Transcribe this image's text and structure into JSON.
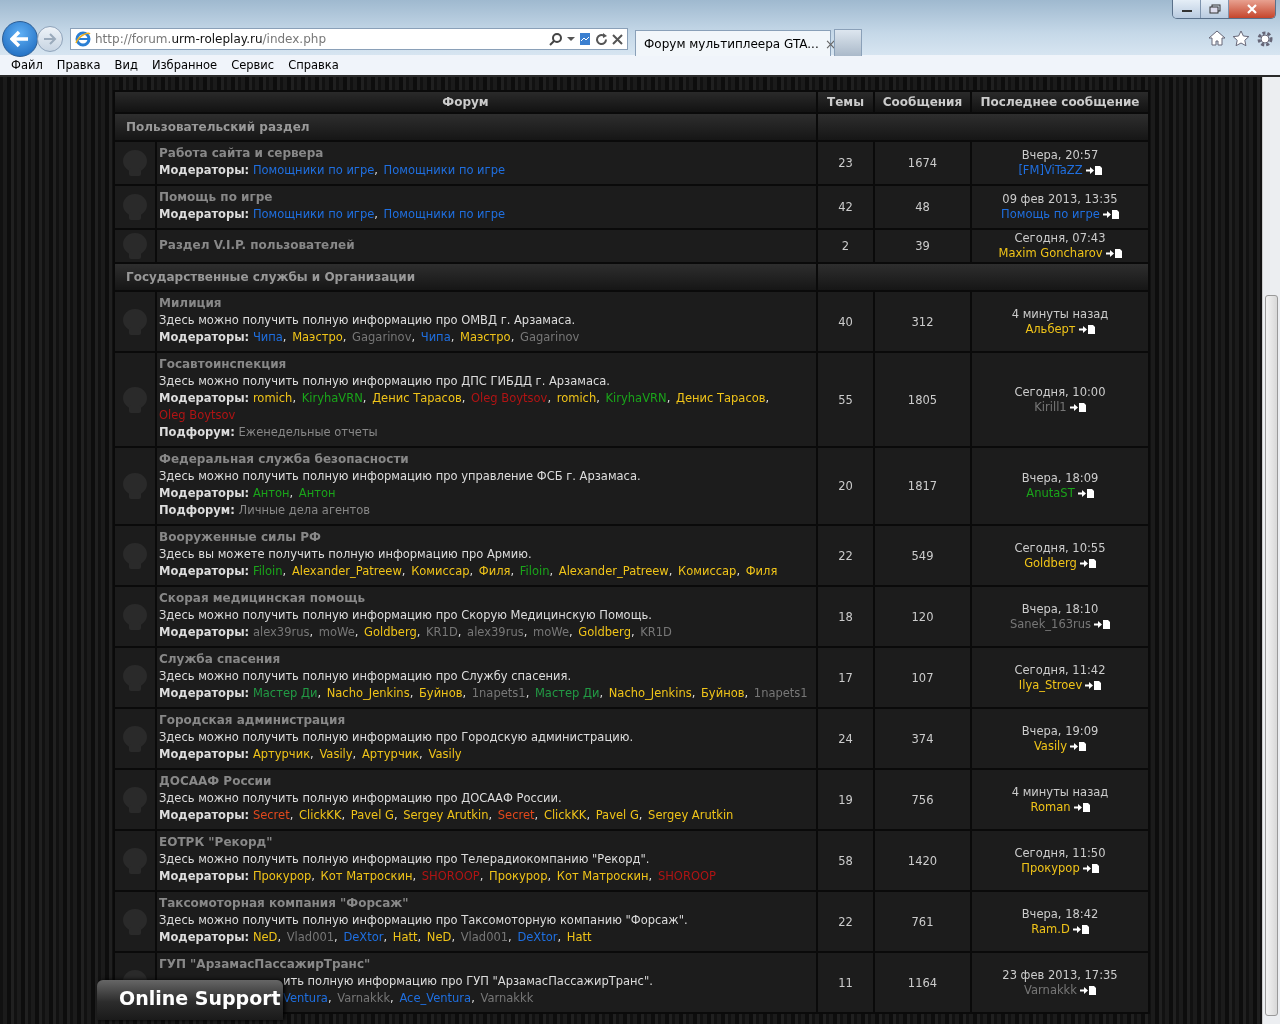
{
  "browser": {
    "address": {
      "prefix": "http://forum.",
      "domain": "urm-roleplay.ru",
      "path": "/index.php"
    },
    "tab_title": "Форум мультиплеера GTA...",
    "tab_close": "×"
  },
  "menu": [
    "Файл",
    "Правка",
    "Вид",
    "Избранное",
    "Сервис",
    "Справка"
  ],
  "table": {
    "columns": [
      "Форум",
      "Темы",
      "Сообщения",
      "Последнее сообщение"
    ],
    "separator": ",",
    "sections": [
      {
        "title": "Пользовательский раздел",
        "forums": [
          {
            "title": "Работа сайта и сервера",
            "moderators_label": "Модераторы:",
            "moderators": [
              {
                "name": "Помощники по игре",
                "color": "#1f6fe0"
              },
              {
                "name": "Помощники по игре",
                "color": "#1f6fe0"
              }
            ],
            "topics": "23",
            "posts": "1674",
            "last_time": "Вчера, 20:57",
            "last_author": {
              "name": "[FM]ViTaZZ",
              "color": "#1f6fe0"
            }
          },
          {
            "title": "Помощь по игре",
            "moderators_label": "Модераторы:",
            "moderators": [
              {
                "name": "Помощники по игре",
                "color": "#1f6fe0"
              },
              {
                "name": "Помощники по игре",
                "color": "#1f6fe0"
              }
            ],
            "topics": "42",
            "posts": "48",
            "last_time": "09 фев 2013, 13:35",
            "last_author": {
              "name": "Помощь по игре",
              "color": "#1f6fe0"
            }
          },
          {
            "title": "Раздел V.I.P. пользователей",
            "topics": "2",
            "posts": "39",
            "last_time": "Сегодня, 07:43",
            "last_author": {
              "name": "Maxim Goncharov",
              "color": "#f0c419"
            }
          }
        ]
      },
      {
        "title": "Государственные службы и Организации",
        "forums": [
          {
            "title": "Милиция",
            "description": "Здесь можно получить полную информацию про ОМВД г. Арзамаса.",
            "moderators_label": "Модераторы:",
            "moderators": [
              {
                "name": "Чипа",
                "color": "#1f6fe0"
              },
              {
                "name": "Маэстро",
                "color": "#f0c419"
              },
              {
                "name": "Gagarinov",
                "color": "#777777"
              },
              {
                "name": "Чипа",
                "color": "#1f6fe0"
              },
              {
                "name": "Маэстро",
                "color": "#f0c419"
              },
              {
                "name": "Gagarinov",
                "color": "#777777"
              }
            ],
            "topics": "40",
            "posts": "312",
            "last_time": "4 минуты назад",
            "last_author": {
              "name": "Альберт",
              "color": "#f0c419"
            }
          },
          {
            "title": "Госавтоинспекция",
            "description": "Здесь можно получить полную информацию про ДПС ГИБДД г. Арзамаса.",
            "moderators_label": "Модераторы:",
            "moderators": [
              {
                "name": "romich",
                "color": "#f0c419"
              },
              {
                "name": "KiryhaVRN",
                "color": "#1aa51a"
              },
              {
                "name": "Денис Тарасов",
                "color": "#f0c419"
              },
              {
                "name": "Oleg Boytsov",
                "color": "#b01414"
              },
              {
                "name": "romich",
                "color": "#f0c419"
              },
              {
                "name": "KiryhaVRN",
                "color": "#1aa51a"
              },
              {
                "name": "Денис Тарасов",
                "color": "#f0c419"
              },
              {
                "name": "Oleg Boytsov",
                "color": "#b01414"
              }
            ],
            "subforum_label": "Подфорум:",
            "subforum": "Еженедельные отчеты",
            "topics": "55",
            "posts": "1805",
            "last_time": "Сегодня, 10:00",
            "last_author": {
              "name": "Kirill1",
              "color": "#777777"
            }
          },
          {
            "title": "Федеральная служба безопасности",
            "description": "Здесь можно получить полную информацию про управление ФСБ г. Арзамаса.",
            "moderators_label": "Модераторы:",
            "moderators": [
              {
                "name": "Антон",
                "color": "#1aa51a"
              },
              {
                "name": "Антон",
                "color": "#1aa51a"
              }
            ],
            "subforum_label": "Подфорум:",
            "subforum": "Личные дела агентов",
            "topics": "20",
            "posts": "1817",
            "last_time": "Вчера, 18:09",
            "last_author": {
              "name": "AnutaST",
              "color": "#1aa51a"
            }
          },
          {
            "title": "Вооруженные силы РФ",
            "description": "Здесь вы можете получить полную информацию про Армию.",
            "moderators_label": "Модераторы:",
            "moderators": [
              {
                "name": "Filoin",
                "color": "#1aa51a"
              },
              {
                "name": "Alexander_Patreew",
                "color": "#f0c419"
              },
              {
                "name": "Комиссар",
                "color": "#f0c419"
              },
              {
                "name": "Филя",
                "color": "#f0c419"
              },
              {
                "name": "Filoin",
                "color": "#1aa51a"
              },
              {
                "name": "Alexander_Patreew",
                "color": "#f0c419"
              },
              {
                "name": "Комиссар",
                "color": "#f0c419"
              },
              {
                "name": "Филя",
                "color": "#f0c419"
              }
            ],
            "topics": "22",
            "posts": "549",
            "last_time": "Сегодня, 10:55",
            "last_author": {
              "name": "Goldberg",
              "color": "#f0c419"
            }
          },
          {
            "title": "Скорая медицинская помощь",
            "description": "Здесь можно получить полную информацию про Скорую Медицинскую Помощь.",
            "moderators_label": "Модераторы:",
            "moderators": [
              {
                "name": "alex39rus",
                "color": "#777777"
              },
              {
                "name": "moWe",
                "color": "#777777"
              },
              {
                "name": "Goldberg",
                "color": "#f0c419"
              },
              {
                "name": "KR1D",
                "color": "#777777"
              },
              {
                "name": "alex39rus",
                "color": "#777777"
              },
              {
                "name": "moWe",
                "color": "#777777"
              },
              {
                "name": "Goldberg",
                "color": "#f0c419"
              },
              {
                "name": "KR1D",
                "color": "#777777"
              }
            ],
            "topics": "18",
            "posts": "120",
            "last_time": "Вчера, 18:10",
            "last_author": {
              "name": "Sanek_163rus",
              "color": "#777777"
            }
          },
          {
            "title": "Служба спасения",
            "description": "Здесь можно получить полную информацию про Службу спасения.",
            "moderators_label": "Модераторы:",
            "moderators": [
              {
                "name": "Мастер Ди",
                "color": "#229944"
              },
              {
                "name": "Nacho_Jenkins",
                "color": "#f0c419"
              },
              {
                "name": "Буйнов",
                "color": "#f0c419"
              },
              {
                "name": "1napets1",
                "color": "#777777"
              },
              {
                "name": "Мастер Ди",
                "color": "#229944"
              },
              {
                "name": "Nacho_Jenkins",
                "color": "#f0c419"
              },
              {
                "name": "Буйнов",
                "color": "#f0c419"
              },
              {
                "name": "1napets1",
                "color": "#777777"
              }
            ],
            "topics": "17",
            "posts": "107",
            "last_time": "Сегодня, 11:42",
            "last_author": {
              "name": "Ilya_Stroev",
              "color": "#f0c419"
            }
          },
          {
            "title": "Городская администрация",
            "description": "Здесь можно получить полную информацию про Городскую администрацию.",
            "moderators_label": "Модераторы:",
            "moderators": [
              {
                "name": "Артурчик",
                "color": "#f0c419"
              },
              {
                "name": "Vasily",
                "color": "#f0c419"
              },
              {
                "name": "Артурчик",
                "color": "#f0c419"
              },
              {
                "name": "Vasily",
                "color": "#f0c419"
              }
            ],
            "topics": "24",
            "posts": "374",
            "last_time": "Вчера, 19:09",
            "last_author": {
              "name": "Vasily",
              "color": "#f0c419"
            }
          },
          {
            "title": "ДОСААФ России",
            "description": "Здесь можно получить полную информацию про ДОСААФ России.",
            "moderators_label": "Модераторы:",
            "moderators": [
              {
                "name": "Secret",
                "color": "#e2481c"
              },
              {
                "name": "ClickKK",
                "color": "#f0c419"
              },
              {
                "name": "Pavel G",
                "color": "#f0c419"
              },
              {
                "name": "Sergey Arutkin",
                "color": "#f0c419"
              },
              {
                "name": "Secret",
                "color": "#e2481c"
              },
              {
                "name": "ClickKK",
                "color": "#f0c419"
              },
              {
                "name": "Pavel G",
                "color": "#f0c419"
              },
              {
                "name": "Sergey Arutkin",
                "color": "#f0c419"
              }
            ],
            "topics": "19",
            "posts": "756",
            "last_time": "4 минуты назад",
            "last_author": {
              "name": "Roman",
              "color": "#f0c419"
            }
          },
          {
            "title": "ЕОТРК \"Рекорд\"",
            "description": "Здесь можно получить полную информацию про Телерадиокомпанию \"Рекорд\".",
            "moderators_label": "Модераторы:",
            "moderators": [
              {
                "name": "Прокурор",
                "color": "#f0c419"
              },
              {
                "name": "Кот Матроскин",
                "color": "#f0c419"
              },
              {
                "name": "SHOROOP",
                "color": "#b01414"
              },
              {
                "name": "Прокурор",
                "color": "#f0c419"
              },
              {
                "name": "Кот Матроскин",
                "color": "#f0c419"
              },
              {
                "name": "SHOROOP",
                "color": "#b01414"
              }
            ],
            "topics": "58",
            "posts": "1420",
            "last_time": "Сегодня, 11:50",
            "last_author": {
              "name": "Прокурор",
              "color": "#f0c419"
            }
          },
          {
            "title": "Таксомоторная компания \"Форсаж\"",
            "description": "Здесь можно получить полную информацию про Таксомоторную компанию \"Форсаж\".",
            "moderators_label": "Модераторы:",
            "moderators": [
              {
                "name": "NeD",
                "color": "#f0c419"
              },
              {
                "name": "Vlad001",
                "color": "#777777"
              },
              {
                "name": "DeXtor",
                "color": "#1f6fe0"
              },
              {
                "name": "Hatt",
                "color": "#f0c419"
              },
              {
                "name": "NeD",
                "color": "#f0c419"
              },
              {
                "name": "Vlad001",
                "color": "#777777"
              },
              {
                "name": "DeXtor",
                "color": "#1f6fe0"
              },
              {
                "name": "Hatt",
                "color": "#f0c419"
              }
            ],
            "topics": "22",
            "posts": "761",
            "last_time": "Вчера, 18:42",
            "last_author": {
              "name": "Ram.D",
              "color": "#f0c419"
            }
          },
          {
            "title": "ГУП \"АрзамасПассажирТранс\"",
            "covered": true,
            "description": "ить полную информацию про ГУП \"АрзамасПассажирТранс\".",
            "moderators": [
              {
                "name": "Ventura",
                "color": "#1f6fe0"
              },
              {
                "name": "Varnakkk",
                "color": "#777777"
              },
              {
                "name": "Ace_Ventura",
                "color": "#1f6fe0"
              },
              {
                "name": "Varnakkk",
                "color": "#777777"
              }
            ],
            "topics": "11",
            "posts": "1164",
            "last_time": "23 фев 2013, 17:35",
            "last_author": {
              "name": "Varnakkk",
              "color": "#777777"
            }
          }
        ]
      }
    ]
  },
  "overlay": {
    "label": "Online Support"
  }
}
